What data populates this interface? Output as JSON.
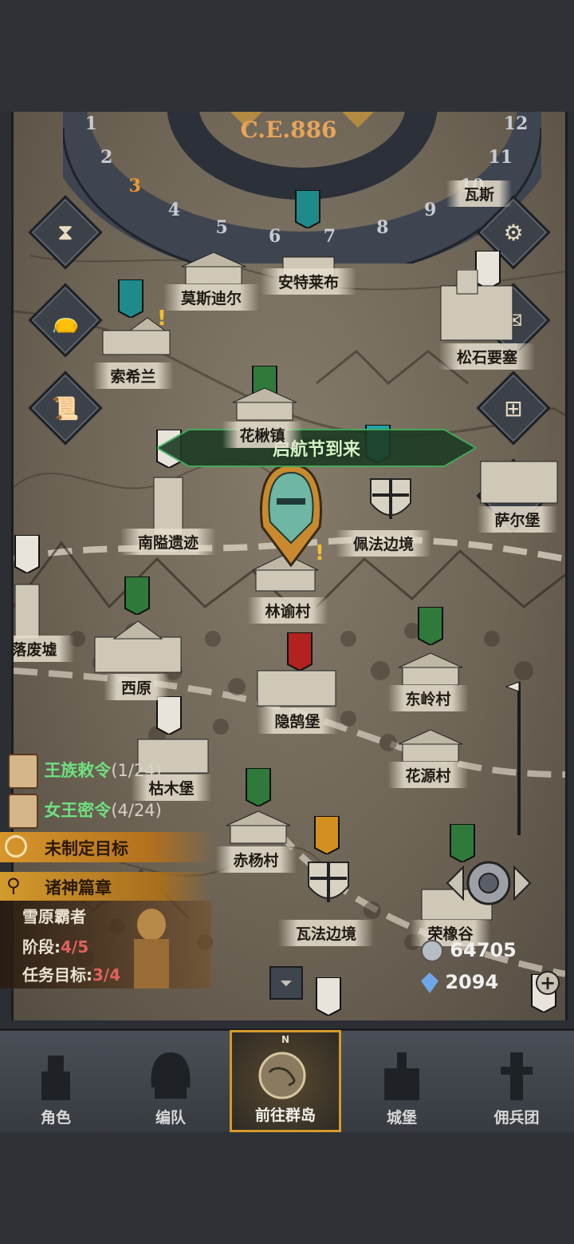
{
  "calendar": {
    "year": "C.E.886",
    "months": [
      "1",
      "2",
      "3",
      "4",
      "5",
      "6",
      "7",
      "8",
      "9",
      "10",
      "11",
      "12"
    ],
    "current_month": "3"
  },
  "event": {
    "text": "启航节到来"
  },
  "locations": [
    {
      "name": "莫斯迪尔"
    },
    {
      "name": "安特莱布"
    },
    {
      "name": "瓦斯"
    },
    {
      "name": "索希兰"
    },
    {
      "name": "松石要塞"
    },
    {
      "name": "花楸镇"
    },
    {
      "name": "南隘遗迹"
    },
    {
      "name": "佩法边境"
    },
    {
      "name": "萨尔堡"
    },
    {
      "name": "林谕村"
    },
    {
      "name": "落废墟"
    },
    {
      "name": "西原"
    },
    {
      "name": "隐鹄堡"
    },
    {
      "name": "东岭村"
    },
    {
      "name": "枯木堡"
    },
    {
      "name": "花源村"
    },
    {
      "name": "赤杨村"
    },
    {
      "name": "瓦法边境"
    },
    {
      "name": "荣橡谷"
    }
  ],
  "quests": [
    {
      "title": "王族敕令",
      "count": "(1/24)"
    },
    {
      "title": "女王密令",
      "count": "(4/24)"
    }
  ],
  "goal": {
    "label": "未制定目标"
  },
  "search": {
    "label": "诸神篇章"
  },
  "chapter": {
    "title": "雪原霸者",
    "stage_label": "阶段:",
    "stage_value": "4/5",
    "task_label": "任务目标:",
    "task_value": "3/4"
  },
  "resources": {
    "silver": "64705",
    "crystal": "2094"
  },
  "nav": [
    {
      "label": "角色"
    },
    {
      "label": "编队"
    },
    {
      "label": "前往群岛",
      "compass": "N"
    },
    {
      "label": "城堡"
    },
    {
      "label": "佣兵团"
    }
  ],
  "colors": {
    "accent": "#d49a2a",
    "quest_green": "#6fe07f",
    "stage_red": "#e0625c",
    "map_parchment": "#7a7061"
  },
  "icons": [
    "hourglass-icon",
    "money-bag-icon",
    "scroll-icon",
    "gear-icon",
    "mail-icon",
    "castle-gate-icon",
    "shield-icon",
    "crosshair-icon",
    "plus-icon",
    "collapse-icon"
  ]
}
